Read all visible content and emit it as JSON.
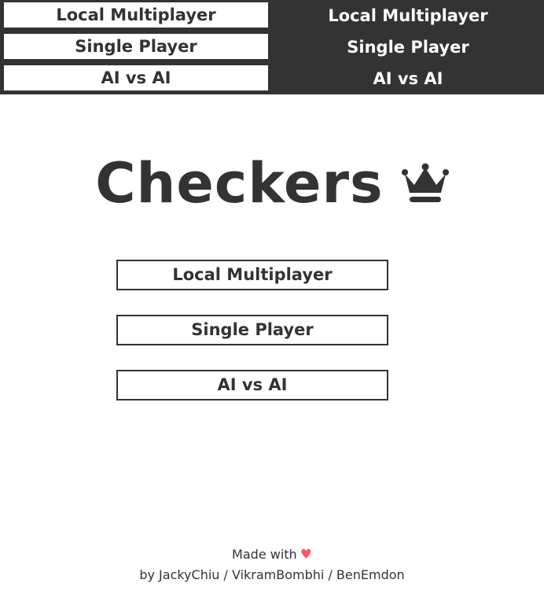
{
  "top_strip": {
    "light_buttons": [
      "Local Multiplayer",
      "Single Player",
      "AI vs AI"
    ],
    "dark_buttons": [
      "Local Multiplayer",
      "Single Player",
      "AI vs AI"
    ]
  },
  "title": {
    "text": "Checkers",
    "icon": "crown-icon"
  },
  "menu": {
    "local_multiplayer": "Local Multiplayer",
    "single_player": "Single Player",
    "ai_vs_ai": "AI vs AI"
  },
  "footer": {
    "made_with": "Made with",
    "heart": "♥",
    "credits": "by JackyChiu / VikramBombhi / BenEmdon"
  },
  "colors": {
    "text": "#333333",
    "dark_band": "#333333",
    "background": "#ffffff",
    "heart": "#ff5a5f"
  }
}
